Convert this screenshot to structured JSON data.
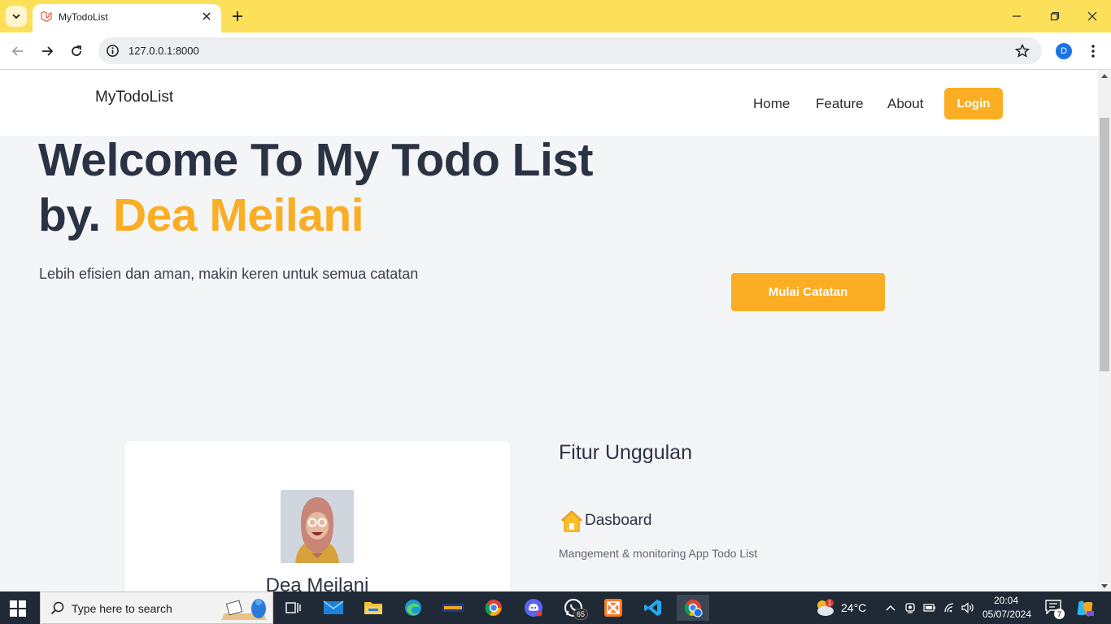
{
  "browser": {
    "tab_title": "MyTodoList",
    "url": "127.0.0.1:8000",
    "profile_initial": "D",
    "accent_color": "#fde05a"
  },
  "site": {
    "brand": "MyTodoList",
    "nav": {
      "home": "Home",
      "feature": "Feature",
      "about": "About",
      "login": "Login"
    },
    "hero": {
      "title_line1": "Welcome To My Todo List",
      "title_prefix": "by.",
      "title_name": "Dea Meilani",
      "subtitle": "Lebih efisien dan aman, makin keren untuk semua catatan",
      "cta": "Mulai Catatan"
    },
    "profile_card": {
      "name": "Dea Meilani"
    },
    "features": {
      "title": "Fitur Unggulan",
      "items": [
        {
          "icon": "house-icon",
          "name": "Dasboard",
          "description": "Mangement & monitoring App Todo List"
        }
      ]
    },
    "colors": {
      "accent": "#fbad23",
      "heading": "#2a3344"
    }
  },
  "taskbar": {
    "search_placeholder": "Type here to search",
    "whatsapp_badge": "65",
    "weather_alert": "1",
    "temperature": "24°C",
    "time": "20:04",
    "date": "05/07/2024",
    "notification_count": "7"
  }
}
